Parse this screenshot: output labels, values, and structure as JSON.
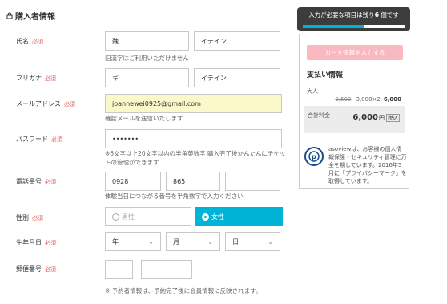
{
  "section_title": "購入者情報",
  "labels": {
    "name": "氏名",
    "furigana": "フリガナ",
    "email": "メールアドレス",
    "password": "パスワード",
    "phone": "電話番号",
    "gender": "性別",
    "birthdate": "生年月日",
    "postal": "郵便番号"
  },
  "required_badge": "必須",
  "fields": {
    "last_name": "魏",
    "first_name": "イテイン",
    "furigana_last": "ギ",
    "furigana_first": "イテイン",
    "email": "joannewei0925@gmail.com",
    "password": "•••••••",
    "phone_1": "0928",
    "phone_2": "865",
    "phone_3": "",
    "postal_1": "",
    "postal_2": ""
  },
  "notes": {
    "name": "旧漢字はご利用いただけません",
    "email": "確認メールを送信いたします",
    "password": "※6文字以上20文字以内の半角英数字 購入完了後かんたんにチケットの管理ができます",
    "phone": "体験当日につながる番号を半角数字で入力ください",
    "footer": "※ 予約者情報は、予約完了後に会員情報に反映されます。"
  },
  "gender": {
    "male": "男性",
    "female": "女性",
    "selected": "female"
  },
  "birthdate": {
    "year": "年",
    "month": "月",
    "day": "日"
  },
  "progress": {
    "text_before": "入力が必要な項目は残り",
    "count": "6",
    "text_after": " 個です",
    "fraction": 0.6,
    "fill_color": "#00b4d8"
  },
  "side_panel": {
    "card_button": "カード情報を入力する",
    "payment_title": "支払い情報",
    "adult_label": "大人",
    "original_price": "3,500",
    "unit_calc": "3,000×2",
    "line_total": "6,000",
    "total_label": "合計料金",
    "total_value": "6,000",
    "yen": "円",
    "tax": "税込",
    "privacy_text": "asoviewは、お客様の個人情報保護・セキュリティ管理に万全を期しています。2016年5月に「プライバシーマーク」を取得しています。"
  },
  "colors": {
    "accent": "#00b4d8",
    "required": "#e05a5a",
    "card_button": "#f8b9c0",
    "email_highlight": "#fbf8c9"
  },
  "icons": [
    "lock-icon",
    "chevron-down-icon",
    "privacy-mark-icon"
  ]
}
